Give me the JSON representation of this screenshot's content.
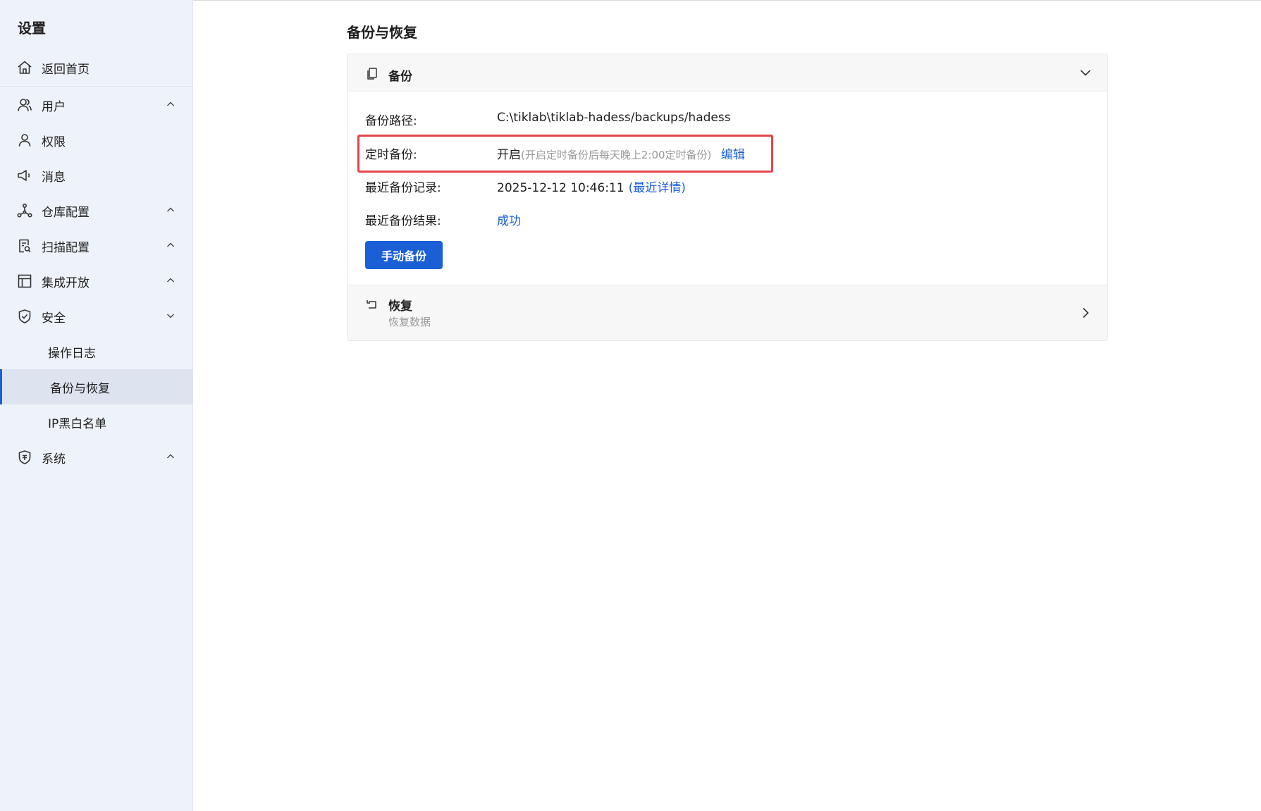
{
  "sidebar": {
    "title": "设置",
    "items": [
      {
        "label": "返回首页",
        "icon": "home-icon"
      },
      {
        "label": "用户",
        "icon": "users-icon",
        "expanded": true
      },
      {
        "label": "权限",
        "icon": "user-icon"
      },
      {
        "label": "消息",
        "icon": "megaphone-icon"
      },
      {
        "label": "仓库配置",
        "icon": "network-icon",
        "expanded": true
      },
      {
        "label": "扫描配置",
        "icon": "scan-doc-icon",
        "expanded": true
      },
      {
        "label": "集成开放",
        "icon": "layout-icon",
        "expanded": true
      },
      {
        "label": "安全",
        "icon": "shield-icon",
        "expanded": false
      },
      {
        "label": "操作日志"
      },
      {
        "label": "备份与恢复",
        "active": true
      },
      {
        "label": "IP黑白名单"
      },
      {
        "label": "系统",
        "icon": "system-shield-icon",
        "expanded": true
      }
    ]
  },
  "main": {
    "page_title": "备份与恢复",
    "backup": {
      "title": "备份",
      "path_label": "备份路径:",
      "path_value": "C:\\tiklab\\tiklab-hadess/backups/hadess",
      "schedule_label": "定时备份:",
      "schedule_status": "开启",
      "schedule_hint": "(开启定时备份后每天晚上2:00定时备份)",
      "schedule_edit": "编辑",
      "recent_label": "最近备份记录:",
      "recent_time": "2025-12-12 10:46:11",
      "recent_details": "(最近详情)",
      "result_label": "最近备份结果:",
      "result_value": "成功",
      "manual_button": "手动备份"
    },
    "restore": {
      "title": "恢复",
      "desc": "恢复数据"
    }
  },
  "colors": {
    "accent": "#1a5fd6",
    "highlight": "#e5434a",
    "sidebar_bg": "#eef2fa"
  }
}
